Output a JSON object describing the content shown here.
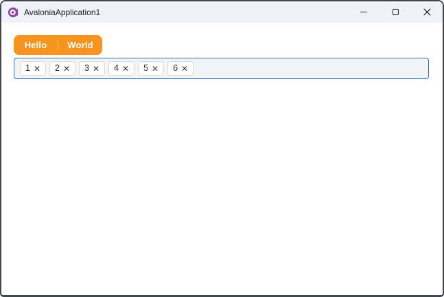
{
  "window": {
    "title": "AvaloniaApplication1",
    "titlebar_buttons": [
      {
        "name": "minimize"
      },
      {
        "name": "maximize"
      },
      {
        "name": "close"
      }
    ]
  },
  "tabs": {
    "items": [
      {
        "label": "Hello",
        "selected": true
      },
      {
        "label": "World",
        "selected": false
      }
    ]
  },
  "chip_input": {
    "chips": [
      {
        "value": "1"
      },
      {
        "value": "2"
      },
      {
        "value": "3"
      },
      {
        "value": "4"
      },
      {
        "value": "5"
      },
      {
        "value": "6"
      }
    ],
    "remove_glyph": "✕"
  },
  "colors": {
    "accent_orange": "#F7941D",
    "focus_border_blue": "#2E76B4",
    "titlebar_bg": "#EFF3F9",
    "logo_purple": "#8B44A4",
    "window_border": "#43474E"
  }
}
